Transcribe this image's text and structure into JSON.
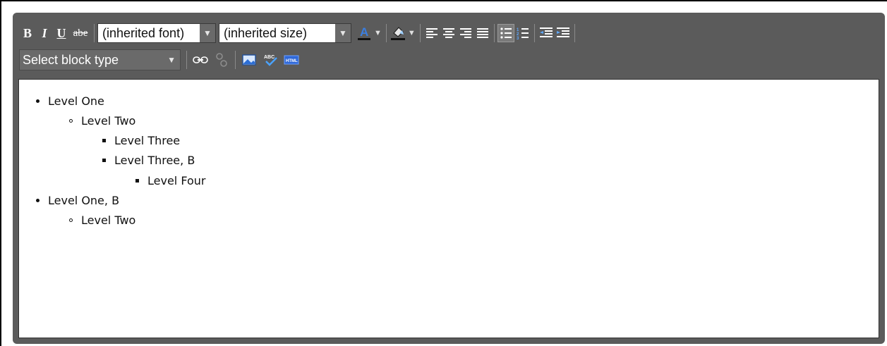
{
  "toolbar": {
    "bold": "B",
    "italic": "I",
    "underline": "U",
    "strike": "abe",
    "font_value": "(inherited font)",
    "size_value": "(inherited size)",
    "block_type_value": "Select block type"
  },
  "content": {
    "items": [
      {
        "text": "Level One",
        "level": 1
      },
      {
        "text": "Level Two",
        "level": 2
      },
      {
        "text": "Level Three",
        "level": 3
      },
      {
        "text": "Level Three, B",
        "level": 3
      },
      {
        "text": "Level Four",
        "level": 4
      },
      {
        "text": "Level One, B",
        "level": 1
      },
      {
        "text": "Level Two",
        "level": 2
      }
    ]
  },
  "colors": {
    "toolbar_bg": "#5b5b5b",
    "accent_blue": "#1a6fd8",
    "text_dark": "#111111"
  },
  "icons": [
    "link-icon",
    "unlink-icon",
    "image-icon",
    "spellcheck-icon",
    "html-icon",
    "font-color-icon",
    "highlight-icon",
    "align-left-icon",
    "align-center-icon",
    "align-right-icon",
    "justify-icon",
    "bullet-list-icon",
    "numbered-list-icon",
    "outdent-icon",
    "indent-icon"
  ]
}
